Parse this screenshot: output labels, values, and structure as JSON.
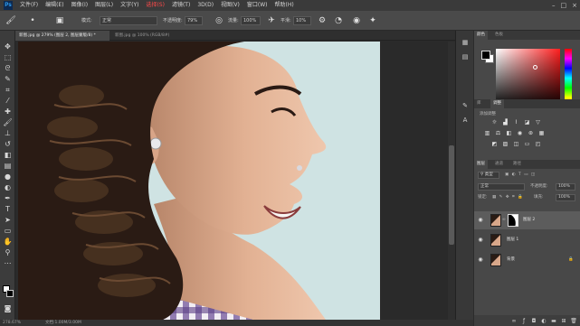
{
  "app": {
    "logo": "Ps"
  },
  "menu": [
    "文件(F)",
    "编辑(E)",
    "图像(I)",
    "图层(L)",
    "文字(Y)",
    "选择(S)",
    "滤镜(T)",
    "3D(D)",
    "视图(V)",
    "窗口(W)",
    "帮助(H)"
  ],
  "window_controls": {
    "minimize": "–",
    "maximize": "□",
    "close": "×"
  },
  "options": {
    "mode_label": "模式:",
    "mode_value": "正常",
    "opacity_label": "不透明度:",
    "opacity_value": "79%",
    "flow_label": "流量:",
    "flow_value": "100%",
    "smooth_label": "平滑:",
    "smooth_value": "10%"
  },
  "tabs": [
    {
      "label": "新图.jpg @ 279% (图层 2, 图层蒙版/8) *",
      "active": true
    },
    {
      "label": "新图.jpg @ 100% (RGB/8#)",
      "active": false
    }
  ],
  "status": {
    "zoom": "278.67%",
    "info": "文档:1.00M/3.00M"
  },
  "panels": {
    "color_tabs": [
      "颜色",
      "色板"
    ],
    "adjust_tabs": [
      "库",
      "调整"
    ],
    "adjust_title": "添加调整",
    "layer_tabs": [
      "图层",
      "通道",
      "路径"
    ],
    "kind_label": "类型",
    "blend_mode": "正常",
    "opacity_label": "不透明度:",
    "opacity_value": "100%",
    "lock_label": "锁定:",
    "fill_label": "填充:",
    "fill_value": "100%",
    "layers": [
      {
        "name": "图层 2",
        "selected": true,
        "mask": true
      },
      {
        "name": "图层 1",
        "selected": false,
        "mask": false
      },
      {
        "name": "背景",
        "selected": false,
        "mask": false
      }
    ]
  },
  "colors": {
    "accent": "#31a8ff",
    "menu_highlight": "#ff4a4a"
  },
  "icons": {
    "tools": [
      "move-icon",
      "marquee-icon",
      "lasso-icon",
      "quick-select-icon",
      "crop-icon",
      "eyedropper-icon",
      "healing-icon",
      "brush-icon",
      "stamp-icon",
      "history-brush-icon",
      "eraser-icon",
      "gradient-icon",
      "blur-icon",
      "dodge-icon",
      "pen-icon",
      "type-icon",
      "path-select-icon",
      "shape-icon",
      "hand-icon",
      "zoom-icon"
    ]
  }
}
